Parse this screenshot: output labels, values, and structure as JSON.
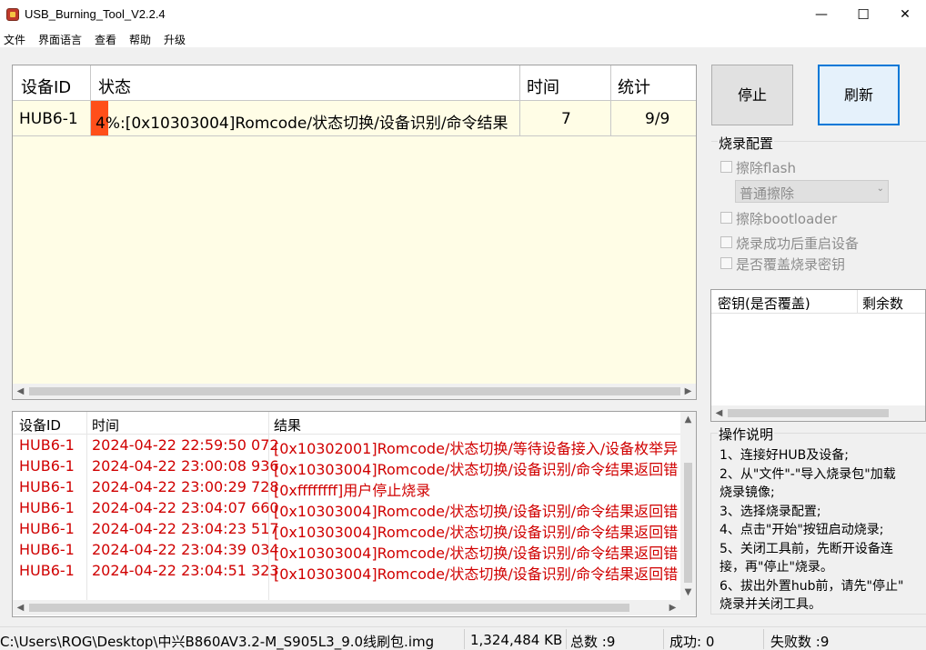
{
  "window": {
    "title": "USB_Burning_Tool_V2.2.4",
    "minimize": "—",
    "maximize": "☐",
    "close": "✕"
  },
  "menu": [
    "文件",
    "界面语言",
    "查看",
    "帮助",
    "升级"
  ],
  "device_table": {
    "headers": {
      "device_id": "设备ID",
      "status": "状态",
      "time": "时间",
      "stats": "统计"
    },
    "row": {
      "device_id": "HUB6-1",
      "status": "4%:[0x10303004]Romcode/状态切换/设备识别/命令结果",
      "progress": 4,
      "time": "7",
      "stats": "9/9"
    }
  },
  "buttons": {
    "stop": "停止",
    "refresh": "刷新"
  },
  "config": {
    "title": "烧录配置",
    "erase_flash": "擦除flash",
    "erase_mode": "普通擦除",
    "erase_bootloader": "擦除bootloader",
    "reboot_after": "烧录成功后重启设备",
    "overwrite_key": "是否覆盖烧录密钥"
  },
  "key_table": {
    "col1": "密钥(是否覆盖)",
    "col2": "剩余数"
  },
  "log_table": {
    "headers": {
      "device_id": "设备ID",
      "time": "时间",
      "result": "结果"
    },
    "rows": [
      {
        "device_id": "HUB6-1",
        "time": "2024-04-22 22:59:50 072",
        "result": "[0x10302001]Romcode/状态切换/等待设备接入/设备枚举异常"
      },
      {
        "device_id": "HUB6-1",
        "time": "2024-04-22 23:00:08 936",
        "result": "[0x10303004]Romcode/状态切换/设备识别/命令结果返回错误"
      },
      {
        "device_id": "HUB6-1",
        "time": "2024-04-22 23:00:29 728",
        "result": "[0xffffffff]用户停止烧录"
      },
      {
        "device_id": "HUB6-1",
        "time": "2024-04-22 23:04:07 660",
        "result": "[0x10303004]Romcode/状态切换/设备识别/命令结果返回错误"
      },
      {
        "device_id": "HUB6-1",
        "time": "2024-04-22 23:04:23 517",
        "result": "[0x10303004]Romcode/状态切换/设备识别/命令结果返回错误"
      },
      {
        "device_id": "HUB6-1",
        "time": "2024-04-22 23:04:39 034",
        "result": "[0x10303004]Romcode/状态切换/设备识别/命令结果返回错误"
      },
      {
        "device_id": "HUB6-1",
        "time": "2024-04-22 23:04:51 323",
        "result": "[0x10303004]Romcode/状态切换/设备识别/命令结果返回错误"
      }
    ]
  },
  "instructions": {
    "title": "操作说明",
    "lines": [
      "1、连接好HUB及设备;",
      "2、从\"文件\"-\"导入烧录包\"加载",
      "烧录镜像;",
      "3、选择烧录配置;",
      "4、点击\"开始\"按钮启动烧录;",
      "5、关闭工具前，先断开设备连",
      "接，再\"停止\"烧录。",
      "6、拔出外置hub前，请先\"停止\"",
      "烧录并关闭工具。"
    ]
  },
  "status_bar": {
    "path": "C:\\Users\\ROG\\Desktop\\中兴B860AV3.2-M_S905L3_9.0线刷包.img",
    "size": "1,324,484 KB",
    "total": "总数 :9",
    "success": "成功:  0",
    "fail": "失败数 :9"
  },
  "colors": {
    "grid_bg": "#fffde6",
    "progress": "#ff4f1a",
    "error_text": "#d00000"
  }
}
